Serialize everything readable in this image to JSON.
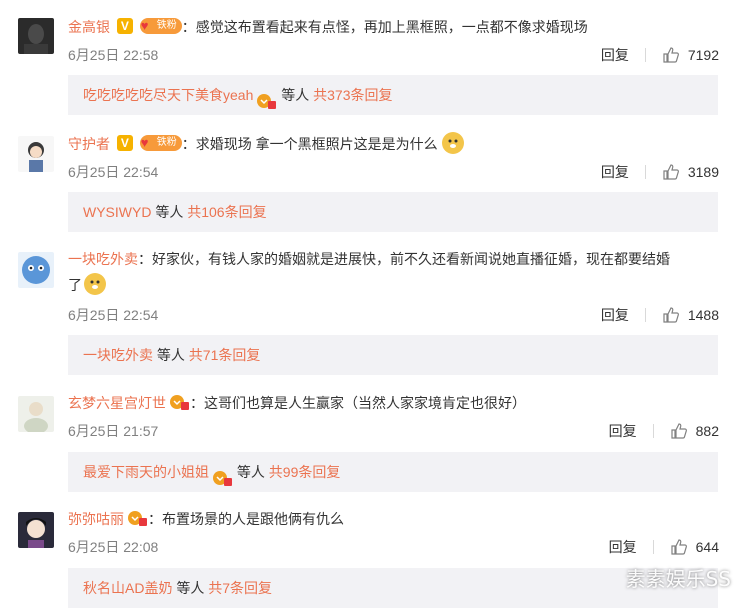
{
  "comments": [
    {
      "user": "金高银",
      "has_v": true,
      "has_fan": true,
      "fan_label": "铁粉",
      "text": "：感觉这布置看起来有点怪，再加上黑框照，一点都不像求婚现场",
      "time": "6月25日 22:58",
      "reply_label": "回复",
      "likes": "7192",
      "reply_user": "吃吃吃吃吃尽天下美食yeah",
      "reply_suffix": "等人",
      "reply_count": "共373条回复"
    },
    {
      "user": "守护者",
      "has_v": true,
      "has_fan": true,
      "fan_label": "铁粉",
      "text": "：求婚现场 拿一个黑框照片这是是为什么",
      "time": "6月25日 22:54",
      "reply_label": "回复",
      "likes": "3189",
      "reply_user": "WYSIWYD",
      "reply_suffix": "等人",
      "reply_count": "共106条回复"
    },
    {
      "user": "一块吃外卖",
      "text_line1": "：好家伙，有钱人家的婚姻就是进展快，前不久还看新闻说她直播征婚，现在都要结婚",
      "text_line2": "了",
      "time": "6月25日 22:54",
      "reply_label": "回复",
      "likes": "1488",
      "reply_user": "一块吃外卖",
      "reply_suffix": "等人",
      "reply_count": "共71条回复"
    },
    {
      "user": "玄梦六星宫灯世",
      "text": "：这哥们也算是人生赢家（当然人家家境肯定也很好）",
      "time": "6月25日 21:57",
      "reply_label": "回复",
      "likes": "882",
      "reply_user": "最爱下雨天的小姐姐",
      "reply_suffix": "等人",
      "reply_count": "共99条回复"
    },
    {
      "user": "弥弥咕丽",
      "text": "：布置场景的人是跟他俩有仇么",
      "time": "6月25日 22:08",
      "reply_label": "回复",
      "likes": "644",
      "reply_user": "秋名山AD盖奶",
      "reply_suffix": "等人",
      "reply_count": "共7条回复"
    }
  ],
  "watermark": "素素娱乐SS",
  "v_badge": "V",
  "colors": {
    "username": "#eb7350",
    "meta": "#808080",
    "reply_bg": "#f2f2f5"
  }
}
